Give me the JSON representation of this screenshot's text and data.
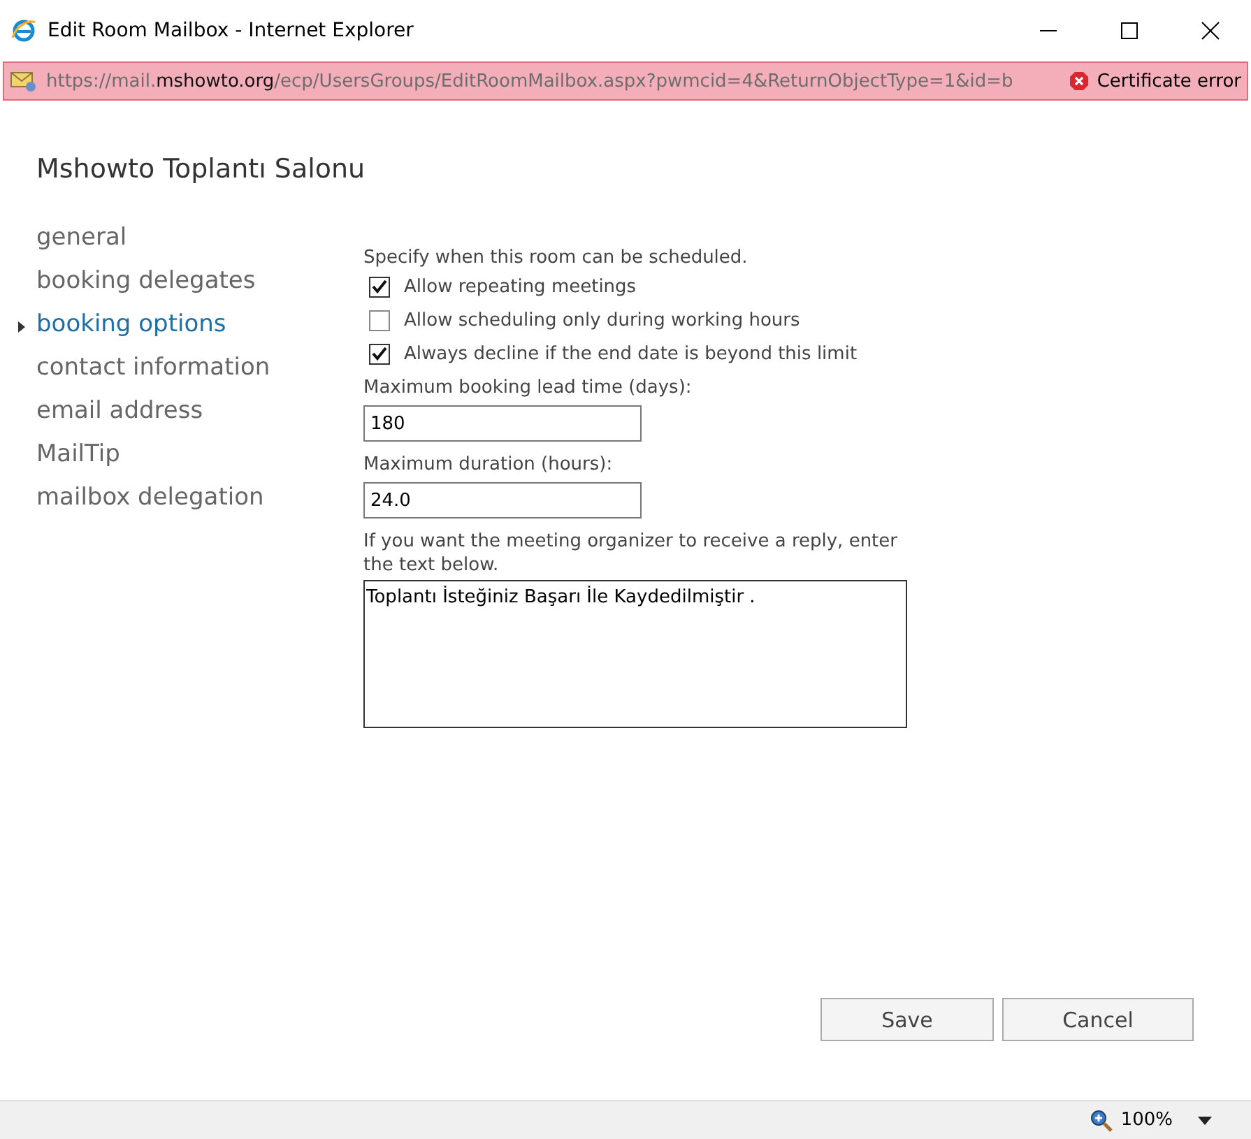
{
  "window": {
    "title": "Edit Room Mailbox - Internet Explorer"
  },
  "address_bar": {
    "url": "https://mail.**mshowto.org**/ecp/UsersGroups/EditRoomMailbox.aspx?pwmcid=4&ReturnObjectType=1&id=b",
    "certificate_error": "Certificate error"
  },
  "page_title": "Mshowto Toplantı Salonu",
  "nav": [
    {
      "label": "general",
      "selected": false
    },
    {
      "label": "booking delegates",
      "selected": false
    },
    {
      "label": "booking options",
      "selected": true
    },
    {
      "label": "contact information",
      "selected": false
    },
    {
      "label": "email address",
      "selected": false
    },
    {
      "label": "MailTip",
      "selected": false
    },
    {
      "label": "mailbox delegation",
      "selected": false
    }
  ],
  "intro": "Specify when this room can be scheduled.",
  "options": [
    {
      "label": "Allow repeating meetings",
      "checked": true
    },
    {
      "label": "Allow scheduling only during working hours",
      "checked": false
    },
    {
      "label": "Always decline if the end date is beyond this limit",
      "checked": true
    }
  ],
  "fields": [
    {
      "label": "Maximum booking lead time (days):",
      "value": "180"
    },
    {
      "label": "Maximum duration (hours):",
      "value": "24.0"
    }
  ],
  "reply": {
    "label": "If you want the meeting organizer to receive a reply, enter the text below.",
    "value": "Toplantı İsteğiniz Başarı İle Kaydedilmiştir ."
  },
  "buttons": [
    "Save",
    "Cancel"
  ],
  "status_bar": {
    "zoom": "100%"
  }
}
